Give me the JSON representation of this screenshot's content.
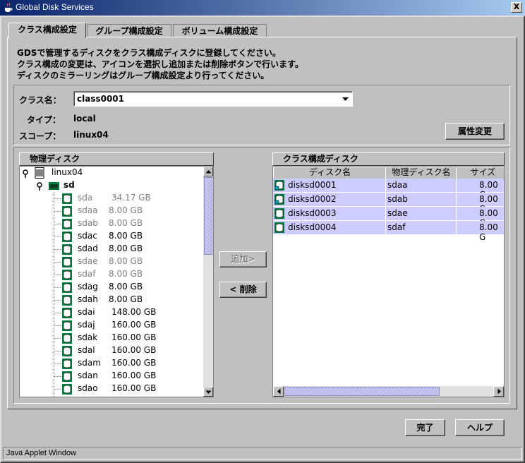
{
  "window": {
    "title": "Global Disk Services",
    "close_label": "X",
    "status": "Java Applet Window"
  },
  "tabs": [
    {
      "label": "クラス構成設定",
      "active": true
    },
    {
      "label": "グループ構成設定",
      "active": false
    },
    {
      "label": "ボリューム構成設定",
      "active": false
    }
  ],
  "instructions": [
    "GDSで管理するディスクをクラス構成ディスクに登録してください。",
    "クラス構成の変更は、アイコンを選択し追加または削除ボタンで行います。",
    "ディスクのミラーリングはグループ構成設定より行ってください。"
  ],
  "class_info": {
    "class_label": "クラス名：",
    "class_value": "class0001",
    "type_label": "タイプ：",
    "type_value": "local",
    "scope_label": "スコープ：",
    "scope_value": "linux04",
    "attr_button": "属性変更"
  },
  "physical_disks": {
    "header": "物理ディスク",
    "host": "linux04",
    "controller": "sd",
    "disks": [
      {
        "name": "sda",
        "size": "34.17 GB",
        "disabled": true
      },
      {
        "name": "sdaa",
        "size": "8.00 GB",
        "disabled": true
      },
      {
        "name": "sdab",
        "size": "8.00 GB",
        "disabled": true
      },
      {
        "name": "sdac",
        "size": "8.00 GB",
        "disabled": false
      },
      {
        "name": "sdad",
        "size": "8.00 GB",
        "disabled": false
      },
      {
        "name": "sdae",
        "size": "8.00 GB",
        "disabled": true
      },
      {
        "name": "sdaf",
        "size": "8.00 GB",
        "disabled": true
      },
      {
        "name": "sdag",
        "size": "8.00 GB",
        "disabled": false
      },
      {
        "name": "sdah",
        "size": "8.00 GB",
        "disabled": false
      },
      {
        "name": "sdai",
        "size": "148.00 GB",
        "disabled": false
      },
      {
        "name": "sdaj",
        "size": "160.00 GB",
        "disabled": false
      },
      {
        "name": "sdak",
        "size": "160.00 GB",
        "disabled": false
      },
      {
        "name": "sdal",
        "size": "160.00 GB",
        "disabled": false
      },
      {
        "name": "sdam",
        "size": "160.00 GB",
        "disabled": false
      },
      {
        "name": "sdan",
        "size": "160.00 GB",
        "disabled": false
      },
      {
        "name": "sdao",
        "size": "160.00 GB",
        "disabled": false
      }
    ]
  },
  "buttons": {
    "add": "追加>",
    "remove": "< 削除",
    "done": "完了",
    "help": "ヘルプ"
  },
  "class_disks": {
    "header": "クラス構成ディスク",
    "columns": [
      "ディスク名",
      "物理ディスク名",
      "サイズ"
    ],
    "rows": [
      {
        "disk": "disksd0001",
        "physical": "sdaa",
        "size": "8.00 G"
      },
      {
        "disk": "disksd0002",
        "physical": "sdab",
        "size": "8.00 G"
      },
      {
        "disk": "disksd0003",
        "physical": "sdae",
        "size": "8.00 G"
      },
      {
        "disk": "disksd0004",
        "physical": "sdaf",
        "size": "8.00 G"
      }
    ]
  },
  "colors": {
    "disk_icon_green": "#008040",
    "selection": "#ccccff",
    "disabled_text": "#808080"
  }
}
